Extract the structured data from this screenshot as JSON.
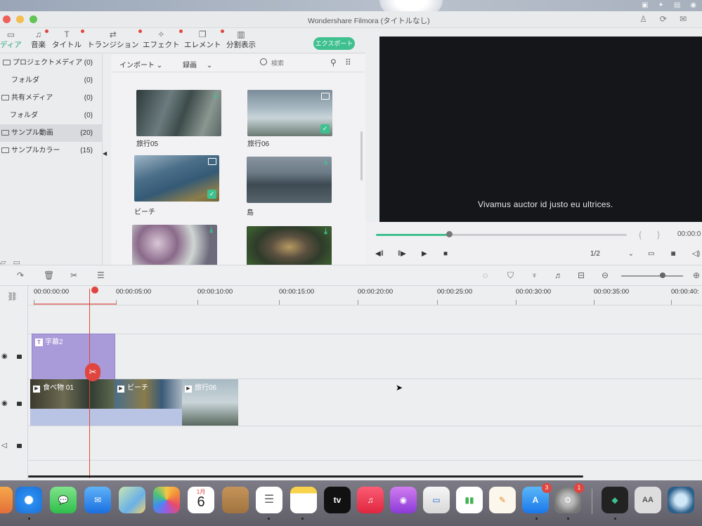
{
  "window": {
    "title": "Wondershare Filmora (タイトルなし)"
  },
  "toolbar": {
    "items": [
      {
        "label": "ディア",
        "icon": "media-folder-icon"
      },
      {
        "label": "音楽",
        "icon": "music-note-icon"
      },
      {
        "label": "タイトル",
        "icon": "title-t-icon"
      },
      {
        "label": "トランジション",
        "icon": "transition-icon"
      },
      {
        "label": "エフェクト",
        "icon": "effect-icon"
      },
      {
        "label": "エレメント",
        "icon": "element-icon"
      },
      {
        "label": "分割表示",
        "icon": "split-screen-icon"
      }
    ],
    "export_label": "エクスポート"
  },
  "library": {
    "items": [
      {
        "label": "プロジェクトメディア",
        "count": "(0)"
      },
      {
        "label": "フォルダ",
        "count": "(0)"
      },
      {
        "label": "共有メディア",
        "count": "(0)"
      },
      {
        "label": "フォルダ",
        "count": "(0)"
      },
      {
        "label": "サンプル動画",
        "count": "(20)"
      },
      {
        "label": "サンプルカラー",
        "count": "(15)"
      }
    ]
  },
  "media": {
    "import_label": "インポート",
    "record_label": "録画",
    "search_placeholder": "検索",
    "items": [
      {
        "label": "旅行05"
      },
      {
        "label": "旅行06"
      },
      {
        "label": "ビーチ"
      },
      {
        "label": "島"
      },
      {
        "label": ""
      },
      {
        "label": ""
      }
    ]
  },
  "preview": {
    "caption": "Vivamus auctor id justo eu ultrices.",
    "progress": 0.29,
    "timecode": "00:00:0",
    "ratio": "1/2"
  },
  "timeline": {
    "ruler": [
      "00:00:00:00",
      "00:00:05:00",
      "00:00:10:00",
      "00:00:15:00",
      "00:00:20:00",
      "00:00:25:00",
      "00:00:30:00",
      "00:00:35:00",
      "00:00:40:"
    ],
    "title_clip": "字幕2",
    "video_clips": [
      {
        "label": "食べ物 01"
      },
      {
        "label": "ビーチ"
      },
      {
        "label": "旅行06"
      }
    ],
    "zoom": 0.62
  },
  "dock": {
    "calendar_month": "1月",
    "calendar_day": "6",
    "tv_label": "tv",
    "appstore_badge": "3",
    "settings_badge": "1",
    "font_label": "AA"
  }
}
